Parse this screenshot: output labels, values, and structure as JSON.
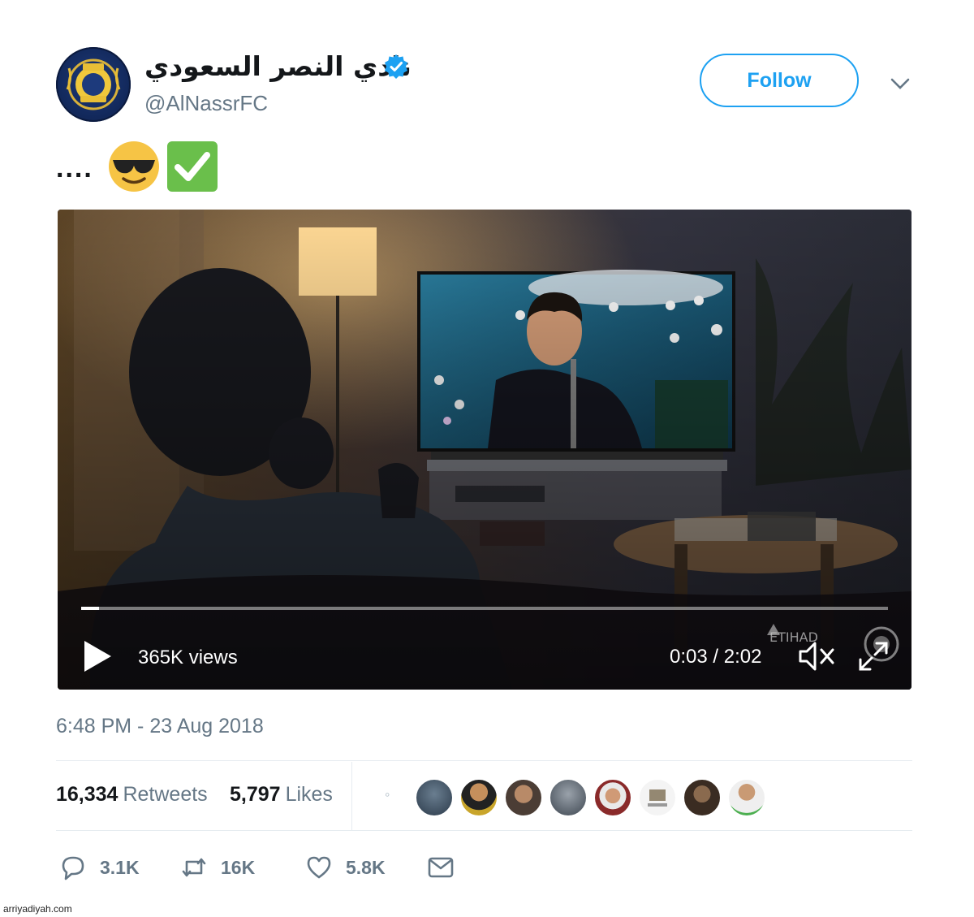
{
  "header": {
    "display_name": "نادي النصر السعودي",
    "handle": "@AlNassrFC",
    "follow_label": "Follow"
  },
  "tweet": {
    "text": "....",
    "emojis": [
      "smiling-face-with-sunglasses-icon",
      "check-mark-button-icon"
    ]
  },
  "video": {
    "views": "365K views",
    "time": "0:03 / 2:02",
    "progress_fraction": 0.022
  },
  "timestamp": "6:48 PM - 23 Aug 2018",
  "stats": {
    "retweets_count": "16,334",
    "retweets_label": "Retweets",
    "likes_count": "5,797",
    "likes_label": "Likes"
  },
  "actions": {
    "reply": "3.1K",
    "retweet": "16K",
    "like": "5.8K"
  },
  "credit": "arriyadiyah.com",
  "colors": {
    "accent": "#1da1f2",
    "muted_text": "#657786",
    "primary_text": "#14171a"
  }
}
